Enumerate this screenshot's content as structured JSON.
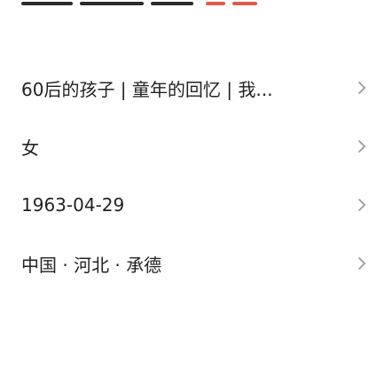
{
  "list": {
    "items": [
      {
        "label": "60后的孩子 | 童年的回忆 | 我..."
      },
      {
        "label": "女"
      },
      {
        "label": "1963-04-29"
      },
      {
        "label": "中国 · 河北 · 承德"
      }
    ]
  },
  "icons": {
    "row_chevron": "chevron-right-icon"
  },
  "colors": {
    "text": "#222222",
    "chevron": "#9a9a9a",
    "background": "#ffffff"
  }
}
